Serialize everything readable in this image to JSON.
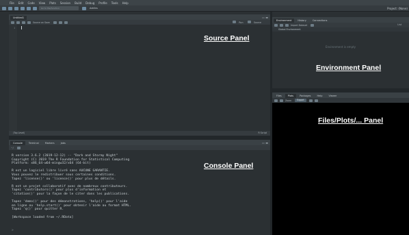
{
  "menu": {
    "items": [
      "File",
      "Edit",
      "Code",
      "View",
      "Plots",
      "Session",
      "Build",
      "Debug",
      "Profile",
      "Tools",
      "Help"
    ]
  },
  "toolbar": {
    "goto_placeholder": "Go to file/function",
    "addins_label": "Addins",
    "project_label": "Project: (None)"
  },
  "source": {
    "tab_label": "Untitled1",
    "source_on_save": "Source on Save",
    "run_label": "Run",
    "source_label": "Source",
    "line_number": "1",
    "status_left": "(Top Level)",
    "status_right": "R Script",
    "overlay_label": "Source Panel"
  },
  "console": {
    "tabs": [
      "Console",
      "Terminal",
      "Markers",
      "Jobs"
    ],
    "path": "~/",
    "lines": "R version 3.6.2 (2019-12-12) -- \"Dark and Stormy Night\"\nCopyright (C) 2019 The R Foundation for Statistical Computing\nPlatform: x86_64-w64-mingw32/x64 (64-bit)\n\nR est un logiciel libre livré sans AUCUNE GARANTIE.\nVous pouvez le redistribuer sous certaines conditions.\nTapez 'license()' ou 'licence()' pour plus de détails.\n\nR est un projet collaboratif avec de nombreux contributeurs.\nTapez 'contributors()' pour plus d'information et\n'citation()' pour la façon de le citer dans les publications.\n\nTapez 'demo()' pour des démonstrations, 'help()' pour l'aide\nen ligne ou 'help.start()' pour obtenir l'aide au format HTML.\nTapez 'q()' pour quitter R.\n\n[Workspace loaded from ~/.RData]",
    "prompt": ">",
    "overlay_label": "Console Panel"
  },
  "environment": {
    "tabs": [
      "Environment",
      "History",
      "Connections"
    ],
    "import_label": "Import Dataset",
    "list_label": "List",
    "scope": "Global Environment",
    "empty_text": "Environment is empty",
    "overlay_label": "Environment Panel"
  },
  "files": {
    "tabs": [
      "Files",
      "Plots",
      "Packages",
      "Help",
      "Viewer"
    ],
    "zoom_label": "Zoom",
    "export_label": "Export",
    "overlay_label": "Files/Plots/... Panel"
  }
}
